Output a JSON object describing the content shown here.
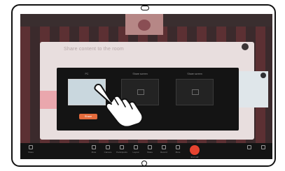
{
  "device": {
    "type": "tablet"
  },
  "screen": {
    "clock": "",
    "share_dialog": {
      "title": "Share content to the room"
    },
    "source_picker": {
      "sources": [
        {
          "label": "PC",
          "sublabel": ""
        },
        {
          "label": "Share screen",
          "sublabel": ""
        },
        {
          "label": "Share screen",
          "sublabel": ""
        }
      ],
      "share_button_label": "Share"
    },
    "toolbar": {
      "left_label": "Share",
      "items": [
        "Mute",
        "Camera",
        "Participants",
        "Layout",
        "Share",
        "Record",
        "More"
      ],
      "end_call_label": "End call",
      "right_items": [
        "",
        ""
      ]
    }
  },
  "overlay": {
    "gesture": "tap-hand-icon"
  },
  "colors": {
    "accent_orange": "#e46b3c",
    "end_call_red": "#e5432f",
    "picker_bg": "#141414",
    "panel_bg": "#e8dede"
  }
}
